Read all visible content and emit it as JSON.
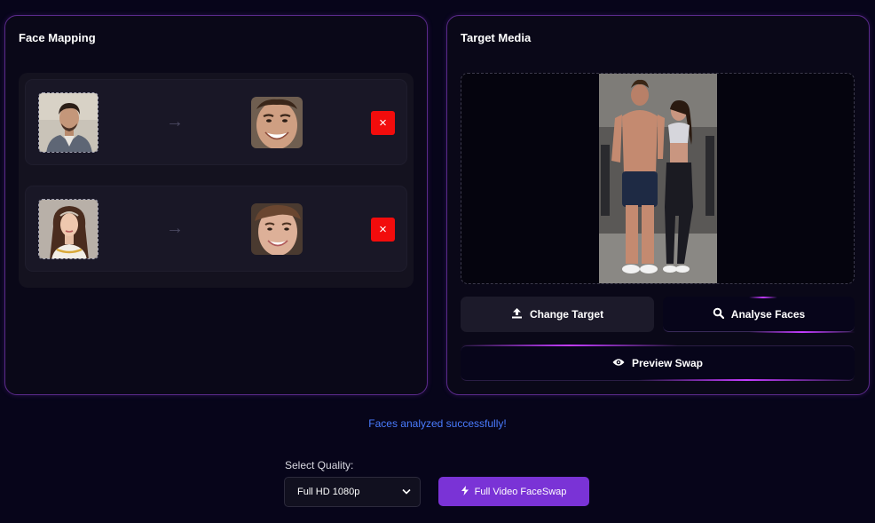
{
  "face_mapping": {
    "title": "Face Mapping",
    "rows": [
      {
        "arrow": "→",
        "delete_label": "×"
      },
      {
        "arrow": "→",
        "delete_label": "×"
      }
    ]
  },
  "target_media": {
    "title": "Target Media",
    "change_target_label": "Change Target",
    "analyse_faces_label": "Analyse Faces",
    "preview_swap_label": "Preview Swap"
  },
  "status": {
    "message": "Faces analyzed successfully!",
    "color": "#4a7cff"
  },
  "quality": {
    "label": "Select Quality:",
    "selected": "Full HD 1080p"
  },
  "full_video_button": {
    "label": "Full Video FaceSwap"
  },
  "colors": {
    "background": "#07051a",
    "accent": "#7a33d6",
    "panel_border": "#5a2a8a",
    "delete": "#f20c0c"
  },
  "icons": {
    "upload": "upload-icon",
    "search": "search-icon",
    "eye": "eye-icon",
    "bolt": "bolt-icon",
    "chevron": "chevron-down-icon",
    "close": "close-icon"
  }
}
